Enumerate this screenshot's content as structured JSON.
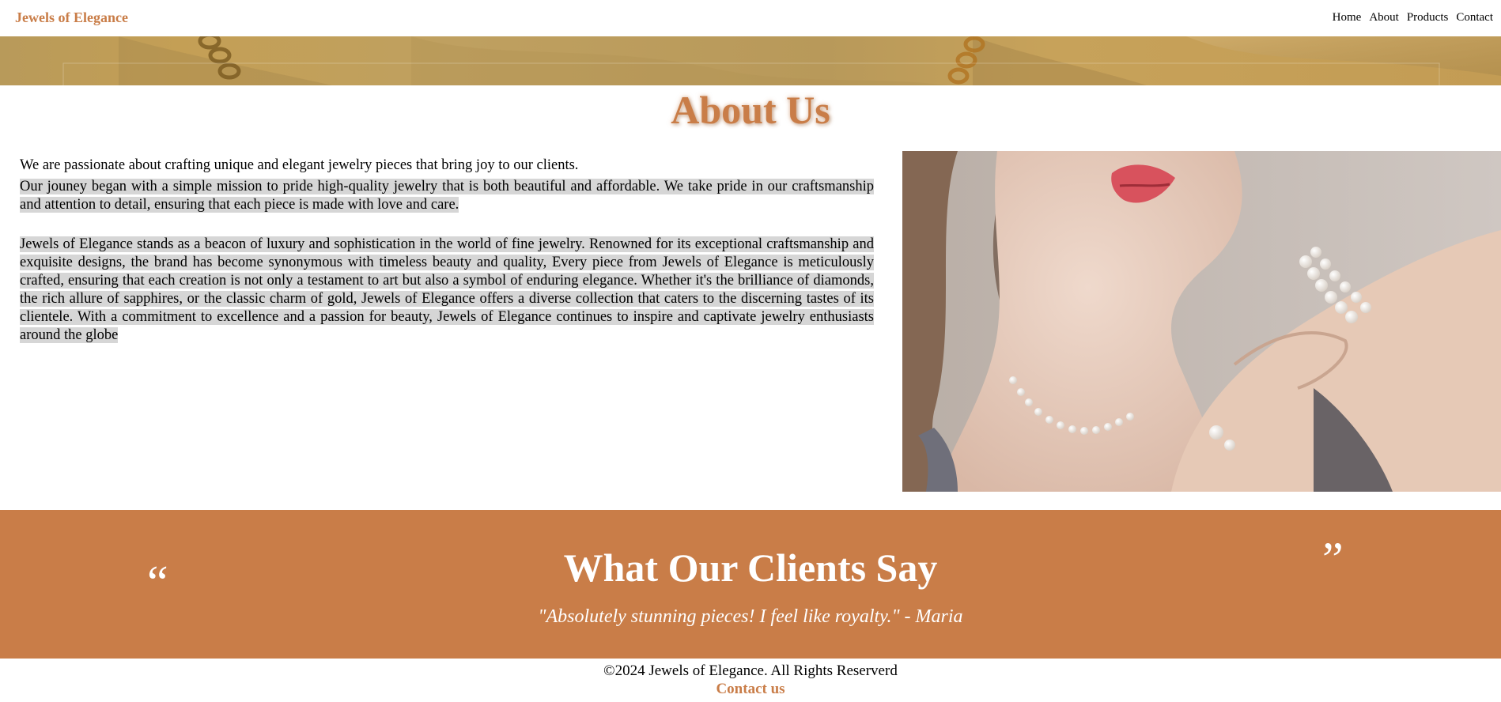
{
  "header": {
    "brand": "Jewels of Elegance",
    "nav": [
      "Home",
      "About",
      "Products",
      "Contact"
    ]
  },
  "about": {
    "title": "About Us",
    "intro": "We are passionate about crafting unique and elegant jewelry pieces that bring joy to our clients.",
    "journey": "Our jouney began with a simple mission to pride high-quality jewelry that is both beautiful and affordable. We take pride in our craftsmanship and attention to detail, ensuring that each piece is made with love and care.",
    "description": "Jewels of Elegance stands as a beacon of luxury and sophistication in the world of fine jewelry. Renowned for its exceptional craftsmanship and exquisite designs, the brand has become synonymous with timeless beauty and quality, Every piece from Jewels of Elegance is meticulously crafted, ensuring that each creation is not only a testament to art but also a symbol of enduring elegance. Whether it's the brilliance of diamonds, the rich allure of sapphires, or the classic charm of gold, Jewels of Elegance offers a diverse collection that caters to the discerning tastes of its clientele. With a commitment to excellence and a passion for beauty, Jewels of Elegance continues to inspire and captivate jewelry enthusiasts around the globe"
  },
  "testimonials": {
    "title": "What Our Clients Say",
    "quote": "\"Absolutely stunning pieces! I feel like royalty.\" - Maria",
    "open_mark": "“",
    "close_mark": "”"
  },
  "footer": {
    "copyright": "©2024 Jewels of Elegance. All Rights Reserverd",
    "contact": "Contact us"
  },
  "colors": {
    "accent": "#c97d48",
    "hero": "#c49f55",
    "highlight": "#d6d6d6"
  },
  "icons": {
    "quote_open": "quote-open-icon",
    "quote_close": "quote-close-icon"
  }
}
